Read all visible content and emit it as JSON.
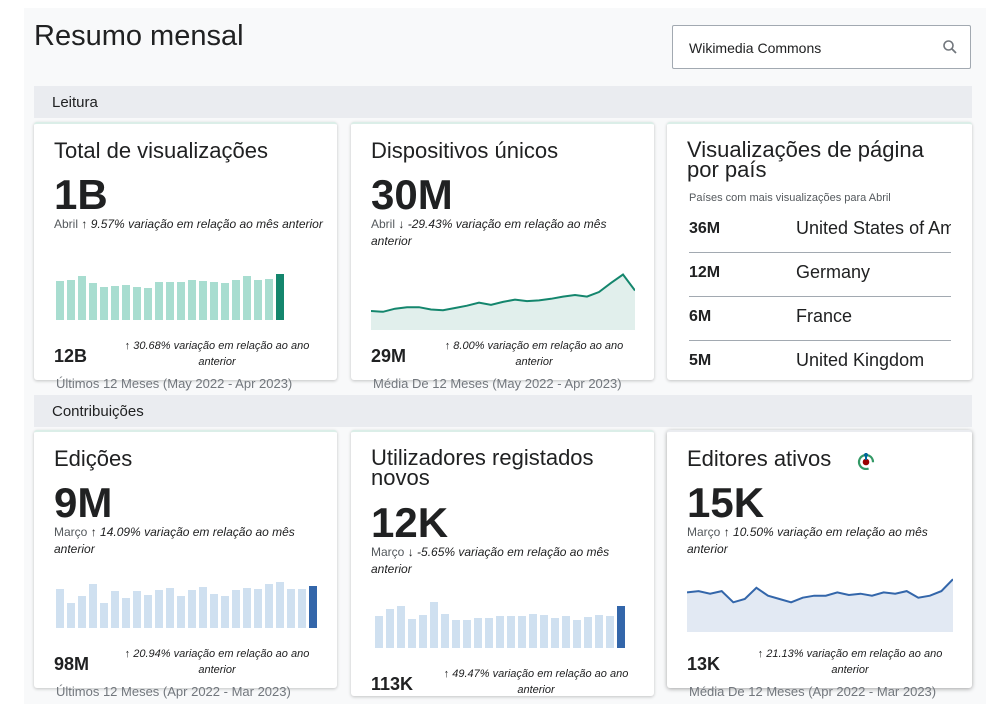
{
  "page_title": "Resumo mensal",
  "search": {
    "value": "Wikimedia Commons"
  },
  "colors": {
    "accent_teal": "#14866d",
    "bar_teal": "#a8ddd0",
    "accent_blue": "#3366aa",
    "bar_blue": "#cfe0f0"
  },
  "sections": [
    {
      "title": "Leitura"
    },
    {
      "title": "Contribuições"
    }
  ],
  "cards": {
    "total_views": {
      "title": "Total de visualizações",
      "value": "1B",
      "month": "Abril",
      "change_arrow": "↑",
      "change_text": "9.57% variação em relação ao mês anterior",
      "total": "12B",
      "yoy_arrow": "↑",
      "yoy_text": "30.68% variação em relação ao ano anterior",
      "period": "Últimos 12 Meses (May 2022 - Apr 2023)",
      "bars": [
        0.85,
        0.88,
        0.95,
        0.8,
        0.72,
        0.75,
        0.76,
        0.72,
        0.7,
        0.82,
        0.82,
        0.82,
        0.88,
        0.85,
        0.82,
        0.8,
        0.88,
        0.95,
        0.88,
        0.9,
        1.0
      ]
    },
    "unique_devices": {
      "title": "Dispositivos únicos",
      "value": "30M",
      "month": "Abril",
      "change_arrow": "↓",
      "change_text": "-29.43% variação em relação ao mês anterior",
      "total": "29M",
      "yoy_arrow": "↑",
      "yoy_text": "8.00% variação em relação ao ano anterior",
      "period": "Média De 12 Meses (May 2022 - Apr 2023)",
      "line": [
        0.25,
        0.24,
        0.28,
        0.3,
        0.3,
        0.27,
        0.26,
        0.29,
        0.32,
        0.36,
        0.33,
        0.37,
        0.4,
        0.38,
        0.39,
        0.41,
        0.44,
        0.46,
        0.44,
        0.5,
        0.62,
        0.73,
        0.52
      ]
    },
    "views_by_country": {
      "title": "Visualizações de página por país",
      "subtitle": "Países com mais visualizações para Abril",
      "rows": [
        {
          "value": "36M",
          "country": "United States of America"
        },
        {
          "value": "12M",
          "country": "Germany"
        },
        {
          "value": "6M",
          "country": "France"
        },
        {
          "value": "5M",
          "country": "United Kingdom"
        }
      ]
    },
    "edits": {
      "title": "Edições",
      "value": "9M",
      "month": "Março",
      "change_arrow": "↑",
      "change_text": "14.09% variação em relação ao mês anterior",
      "total": "98M",
      "yoy_arrow": "↑",
      "yoy_text": "20.94% variação em relação ao ano anterior",
      "period": "Últimos 12 Meses (Apr 2022 - Mar 2023)",
      "bars": [
        0.85,
        0.55,
        0.7,
        0.95,
        0.55,
        0.8,
        0.65,
        0.8,
        0.72,
        0.82,
        0.88,
        0.7,
        0.82,
        0.9,
        0.75,
        0.7,
        0.82,
        0.88,
        0.85,
        0.95,
        1.0,
        0.85,
        0.85,
        0.92
      ]
    },
    "new_registered": {
      "title": "Utilizadores registados novos",
      "value": "12K",
      "month": "Março",
      "change_arrow": "↓",
      "change_text": "-5.65% variação em relação ao mês anterior",
      "total": "113K",
      "yoy_arrow": "↑",
      "yoy_text": "49.47% variação em relação ao ano anterior",
      "bars": [
        0.7,
        0.85,
        0.92,
        0.62,
        0.72,
        1.0,
        0.75,
        0.6,
        0.6,
        0.65,
        0.65,
        0.7,
        0.7,
        0.7,
        0.75,
        0.72,
        0.65,
        0.7,
        0.6,
        0.68,
        0.72,
        0.7,
        0.92
      ]
    },
    "active_editors": {
      "title": "Editores ativos",
      "value": "15K",
      "month": "Março",
      "change_arrow": "↑",
      "change_text": "10.50% variação em relação ao mês anterior",
      "total": "13K",
      "yoy_arrow": "↑",
      "yoy_text": "21.13% variação em relação ao ano anterior",
      "period": "Média De 12 Meses (Apr 2022 - Mar 2023)",
      "line": [
        0.6,
        0.62,
        0.58,
        0.62,
        0.45,
        0.5,
        0.67,
        0.55,
        0.5,
        0.45,
        0.52,
        0.55,
        0.55,
        0.6,
        0.56,
        0.58,
        0.55,
        0.6,
        0.58,
        0.62,
        0.52,
        0.55,
        0.62,
        0.8
      ]
    }
  }
}
